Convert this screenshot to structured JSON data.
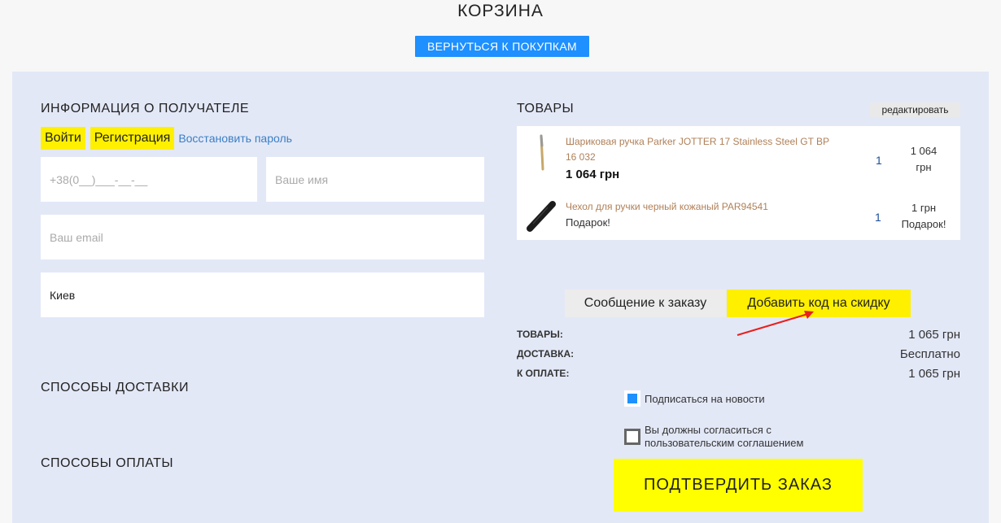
{
  "page": {
    "title": "КОРЗИНА",
    "back_label": "ВЕРНУТЬСЯ К ПОКУПКАМ"
  },
  "recipient": {
    "title": "ИНФОРМАЦИЯ О ПОЛУЧАТЕЛЕ",
    "login_label": "Войти",
    "register_label": "Регистрация",
    "restore_label": "Восстановить пароль",
    "phone_placeholder": "+38(0__)___-__-__",
    "name_placeholder": "Ваше имя",
    "email_placeholder": "Ваш email",
    "city_value": "Киев"
  },
  "delivery": {
    "title": "СПОСОБЫ ДОСТАВКИ"
  },
  "payment": {
    "title": "СПОСОБЫ ОПЛАТЫ"
  },
  "cart": {
    "title": "ТОВАРЫ",
    "edit_label": "редактировать",
    "items": [
      {
        "name": "Шариковая ручка Parker JOTTER 17 Stainless Steel GT BP 16 032",
        "price": "1 064 грн",
        "qty": "1",
        "total_line1": "1 064",
        "total_line2": "грн"
      },
      {
        "name": "Чехол для ручки черный кожаный PAR94541",
        "gift": "Подарок!",
        "qty": "1",
        "total_line1": "1 грн",
        "total_line2": "Подарок!"
      }
    ]
  },
  "actions": {
    "message_label": "Сообщение к заказу",
    "promo_label": "Добавить код на скидку"
  },
  "summary": {
    "goods_label": "ТОВАРЫ:",
    "goods_value": "1 065 грн",
    "delivery_label": "ДОСТАВКА:",
    "delivery_value": "Бесплатно",
    "total_label": "К ОПЛАТЕ:",
    "total_value": "1 065 грн"
  },
  "checks": {
    "subscribe_label": "Подписаться на новости",
    "agree_line1": "Вы должны согласиться с",
    "agree_line2": "пользовательским соглашением"
  },
  "confirm_label": "ПОДТВЕРДИТЬ ЗАКАЗ",
  "colors": {
    "accent_blue": "#1e90ff",
    "highlight_yellow": "#fff000",
    "panel_bg": "#e3e8f7",
    "annotation_arrow": "#e8201e"
  }
}
